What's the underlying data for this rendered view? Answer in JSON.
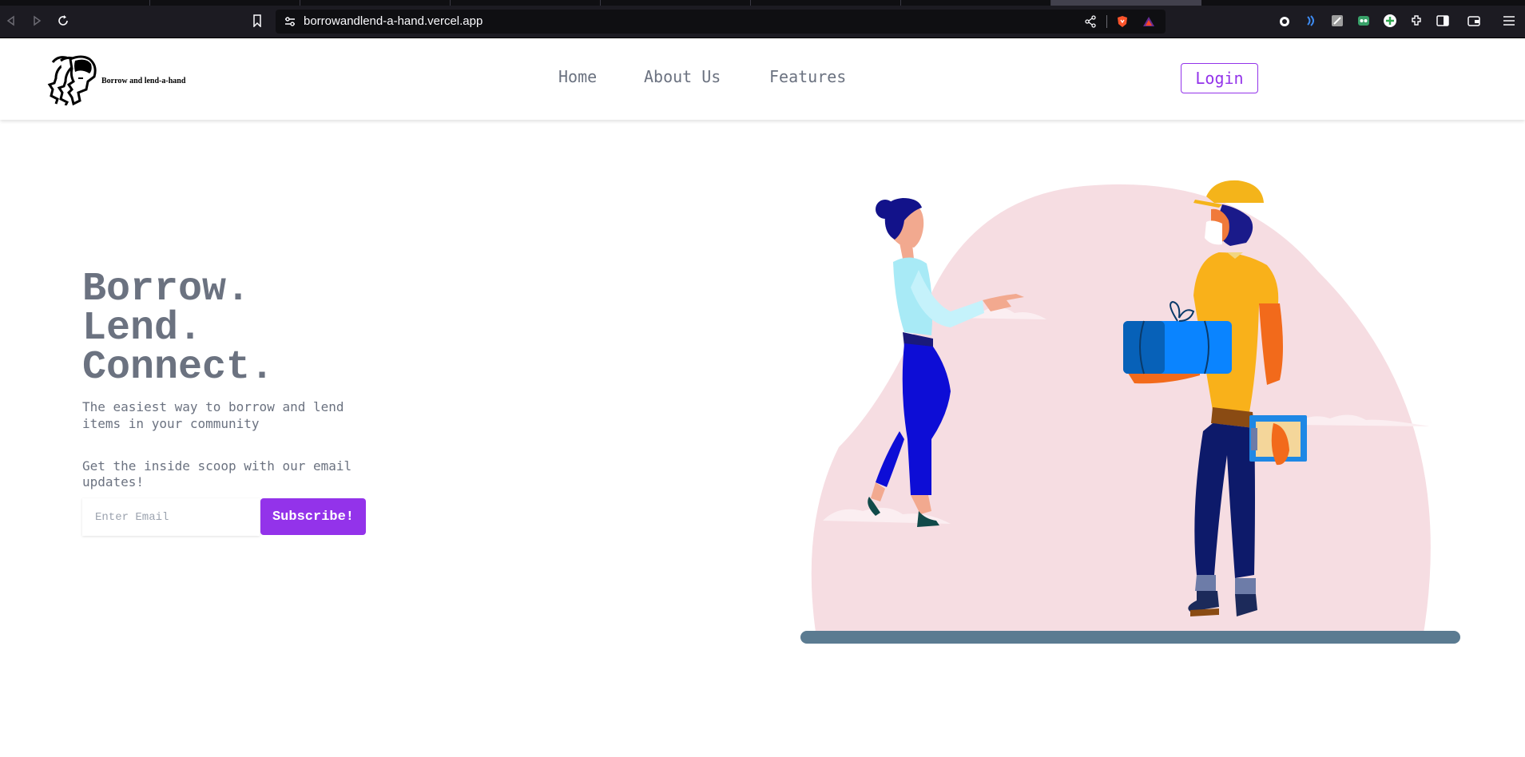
{
  "browser": {
    "url": "borrowandlend-a-hand.vercel.app"
  },
  "site": {
    "brand": "Borrow and lend-a-hand",
    "nav": [
      {
        "label": "Home"
      },
      {
        "label": "About Us"
      },
      {
        "label": "Features"
      }
    ],
    "login_label": "Login"
  },
  "hero": {
    "title_lines": [
      "Borrow.",
      "Lend.",
      "Connect."
    ],
    "subtitle": "The easiest way to borrow and lend items in your community",
    "scoop": "Get the inside scoop with our email updates!",
    "email_placeholder": "Enter Email",
    "subscribe_label": "Subscribe!"
  },
  "colors": {
    "accent": "#9333ea",
    "text_gray": "#6b7280",
    "blob_pink": "#f6dde2",
    "ground": "#5b7b91"
  },
  "icons": [
    "back-icon",
    "forward-icon",
    "reload-icon",
    "bookmark-icon",
    "site-settings-icon",
    "share-icon",
    "brave-shield-icon",
    "rewards-icon",
    "extension-icon",
    "sidebar-icon",
    "wallet-icon",
    "menu-icon"
  ]
}
